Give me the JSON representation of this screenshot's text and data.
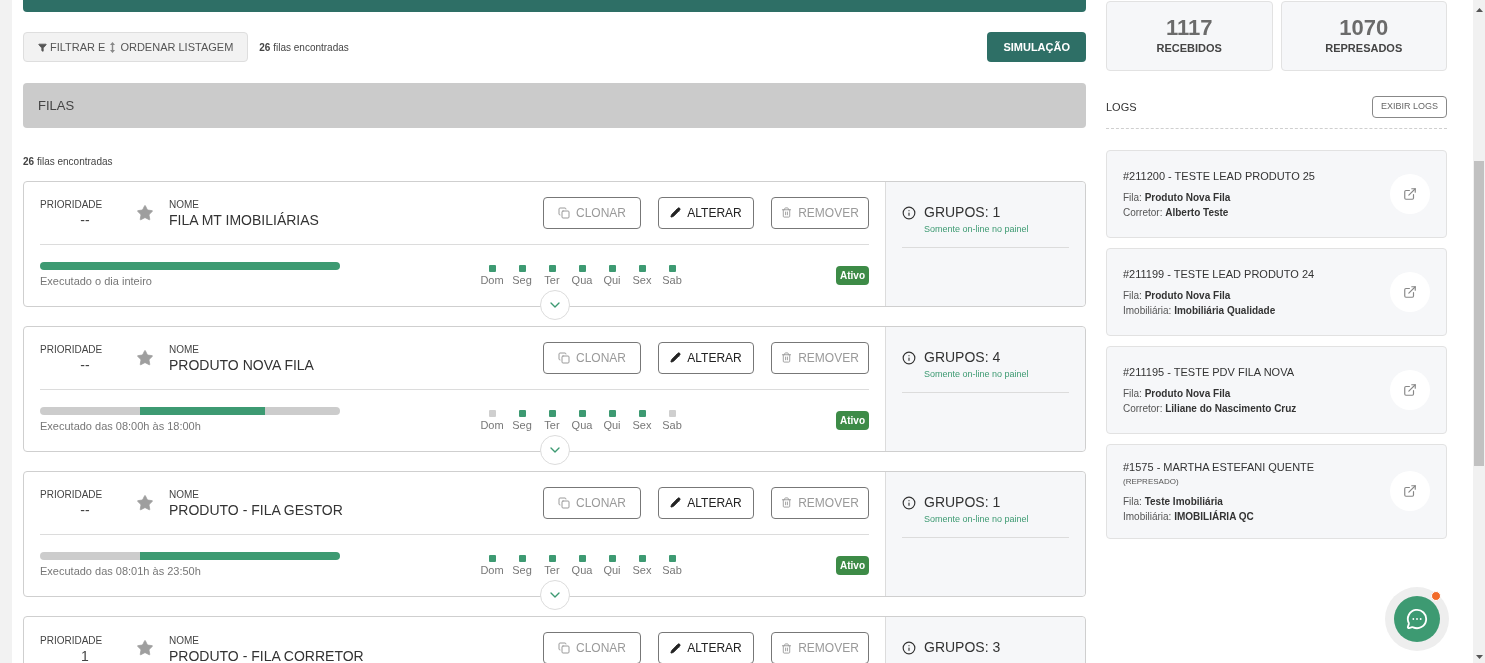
{
  "toolbar": {
    "filter_button": "FILTRAR E",
    "order_button": "ORDENAR LISTAGEM",
    "count": "26",
    "count_label": "filas encontradas",
    "simulation_button": "SIMULAÇÃO"
  },
  "section": {
    "title": "FILAS",
    "count": "26",
    "count_label": "filas encontradas"
  },
  "queues": [
    {
      "priority_label": "PRIORIDADE",
      "priority": "--",
      "name_label": "NOME",
      "name": "FILA MT IMOBILIÁRIAS",
      "actions": [
        {
          "kind": "clone",
          "label": "CLONAR",
          "disabled": true
        },
        {
          "kind": "edit",
          "label": "ALTERAR",
          "disabled": false
        },
        {
          "kind": "remove",
          "label": "REMOVER",
          "disabled": true
        }
      ],
      "hours": [
        {
          "active": true
        },
        {
          "active": true
        },
        {
          "active": true
        },
        {
          "active": true
        },
        {
          "active": true
        },
        {
          "active": true
        },
        {
          "active": true
        },
        {
          "active": true
        },
        {
          "active": true
        },
        {
          "active": true
        },
        {
          "active": true
        },
        {
          "active": true
        },
        {
          "active": true
        },
        {
          "active": true
        },
        {
          "active": true
        },
        {
          "active": true
        },
        {
          "active": true
        },
        {
          "active": true
        },
        {
          "active": true
        },
        {
          "active": true
        },
        {
          "active": true
        },
        {
          "active": true
        },
        {
          "active": true
        },
        {
          "active": true
        }
      ],
      "schedule_text": "Executado o dia inteiro",
      "days": [
        {
          "label": "Dom",
          "active": true
        },
        {
          "label": "Seg",
          "active": true
        },
        {
          "label": "Ter",
          "active": true
        },
        {
          "label": "Qua",
          "active": true
        },
        {
          "label": "Qui",
          "active": true
        },
        {
          "label": "Sex",
          "active": true
        },
        {
          "label": "Sab",
          "active": true
        }
      ],
      "status": "Ativo",
      "groups": "GRUPOS: 1",
      "groups_note": "Somente on-line no painel"
    },
    {
      "priority_label": "PRIORIDADE",
      "priority": "--",
      "name_label": "NOME",
      "name": "PRODUTO NOVA FILA",
      "actions": [
        {
          "kind": "clone",
          "label": "CLONAR",
          "disabled": true
        },
        {
          "kind": "edit",
          "label": "ALTERAR",
          "disabled": false
        },
        {
          "kind": "remove",
          "label": "REMOVER",
          "disabled": true
        }
      ],
      "hours": [
        {
          "active": false
        },
        {
          "active": false
        },
        {
          "active": false
        },
        {
          "active": false
        },
        {
          "active": false
        },
        {
          "active": false
        },
        {
          "active": false
        },
        {
          "active": false
        },
        {
          "active": true
        },
        {
          "active": true
        },
        {
          "active": true
        },
        {
          "active": true
        },
        {
          "active": true
        },
        {
          "active": true
        },
        {
          "active": true
        },
        {
          "active": true
        },
        {
          "active": true
        },
        {
          "active": true
        },
        {
          "active": false
        },
        {
          "active": false
        },
        {
          "active": false
        },
        {
          "active": false
        },
        {
          "active": false
        },
        {
          "active": false
        }
      ],
      "schedule_text": "Executado das 08:00h às 18:00h",
      "days": [
        {
          "label": "Dom",
          "active": false
        },
        {
          "label": "Seg",
          "active": true
        },
        {
          "label": "Ter",
          "active": true
        },
        {
          "label": "Qua",
          "active": true
        },
        {
          "label": "Qui",
          "active": true
        },
        {
          "label": "Sex",
          "active": true
        },
        {
          "label": "Sab",
          "active": false
        }
      ],
      "status": "Ativo",
      "groups": "GRUPOS: 4",
      "groups_note": "Somente on-line no painel"
    },
    {
      "priority_label": "PRIORIDADE",
      "priority": "--",
      "name_label": "NOME",
      "name": "PRODUTO - FILA GESTOR",
      "actions": [
        {
          "kind": "clone",
          "label": "CLONAR",
          "disabled": true
        },
        {
          "kind": "edit",
          "label": "ALTERAR",
          "disabled": false
        },
        {
          "kind": "remove",
          "label": "REMOVER",
          "disabled": true
        }
      ],
      "hours": [
        {
          "active": false
        },
        {
          "active": false
        },
        {
          "active": false
        },
        {
          "active": false
        },
        {
          "active": false
        },
        {
          "active": false
        },
        {
          "active": false
        },
        {
          "active": false
        },
        {
          "active": true
        },
        {
          "active": true
        },
        {
          "active": true
        },
        {
          "active": true
        },
        {
          "active": true
        },
        {
          "active": true
        },
        {
          "active": true
        },
        {
          "active": true
        },
        {
          "active": true
        },
        {
          "active": true
        },
        {
          "active": true
        },
        {
          "active": true
        },
        {
          "active": true
        },
        {
          "active": true
        },
        {
          "active": true
        },
        {
          "active": true
        }
      ],
      "schedule_text": "Executado das 08:01h às 23:50h",
      "days": [
        {
          "label": "Dom",
          "active": true
        },
        {
          "label": "Seg",
          "active": true
        },
        {
          "label": "Ter",
          "active": true
        },
        {
          "label": "Qua",
          "active": true
        },
        {
          "label": "Qui",
          "active": true
        },
        {
          "label": "Sex",
          "active": true
        },
        {
          "label": "Sab",
          "active": true
        }
      ],
      "status": "Ativo",
      "groups": "GRUPOS: 1",
      "groups_note": "Somente on-line no painel"
    },
    {
      "priority_label": "PRIORIDADE",
      "priority": "1",
      "name_label": "NOME",
      "name": "PRODUTO - FILA CORRETOR",
      "actions": [
        {
          "kind": "clone",
          "label": "CLONAR",
          "disabled": true
        },
        {
          "kind": "edit",
          "label": "ALTERAR",
          "disabled": false
        },
        {
          "kind": "remove",
          "label": "REMOVER",
          "disabled": true
        }
      ],
      "groups": "GRUPOS: 3"
    }
  ],
  "stats": [
    {
      "value": "1117",
      "label": "RECEBIDOS"
    },
    {
      "value": "1070",
      "label": "REPRESADOS"
    }
  ],
  "logs": {
    "title": "LOGS",
    "button": "EXIBIR LOGS",
    "items": [
      {
        "title": "#211200 - TESTE LEAD PRODUTO 25",
        "fields": [
          {
            "label": "Fila:",
            "value": "Produto Nova Fila"
          },
          {
            "label": "Corretor:",
            "value": "Alberto Teste"
          }
        ]
      },
      {
        "title": "#211199 - TESTE LEAD PRODUTO 24",
        "fields": [
          {
            "label": "Fila:",
            "value": "Produto Nova Fila"
          },
          {
            "label": "Imobiliária:",
            "value": "Imobiliária Qualidade"
          }
        ]
      },
      {
        "title": "#211195 - TESTE PDV FILA NOVA",
        "fields": [
          {
            "label": "Fila:",
            "value": "Produto Nova Fila"
          },
          {
            "label": "Corretor:",
            "value": "Liliane do Nascimento Cruz"
          }
        ]
      },
      {
        "title": "#1575 - MARTHA ESTEFANI QUENTE",
        "subtitle": "(REPRESADO)",
        "fields": [
          {
            "label": "Fila:",
            "value": "Teste Imobiliária"
          },
          {
            "label": "Imobiliária:",
            "value": "IMOBILIÁRIA QC"
          }
        ]
      }
    ]
  }
}
